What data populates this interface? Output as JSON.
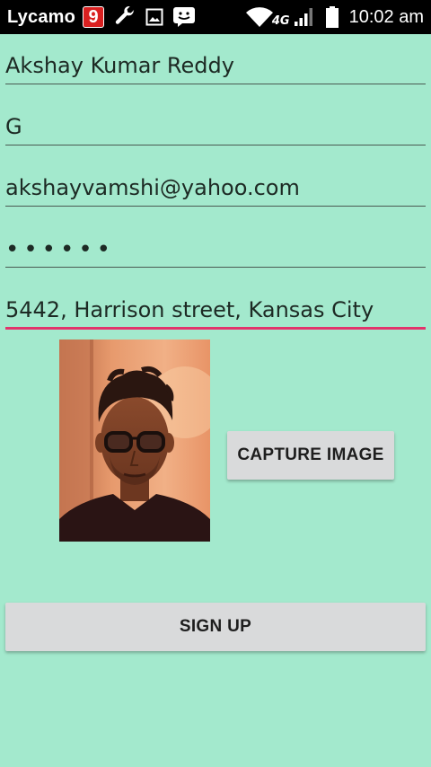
{
  "status_bar": {
    "carrier": "Lycamo",
    "badge_number": "9",
    "network_type": "4G",
    "time": "10:02 am",
    "icons": [
      "nine-app-icon",
      "wrench-icon",
      "image-icon",
      "messenger-icon",
      "wifi-icon",
      "signal-icon",
      "battery-icon"
    ]
  },
  "form": {
    "first_name": "Akshay Kumar Reddy",
    "last_name": "G",
    "email": "akshayvamshi@yahoo.com",
    "password_masked": "••••••",
    "address": "5442, Harrison street, Kansas City"
  },
  "photo": {
    "icon": "profile-photo"
  },
  "buttons": {
    "capture_label": "CAPTURE IMAGE",
    "signup_label": "SIGN UP"
  },
  "colors": {
    "background": "#a3e9cd",
    "focus_underline": "#e2336b",
    "button_bg": "#d9dadb"
  }
}
